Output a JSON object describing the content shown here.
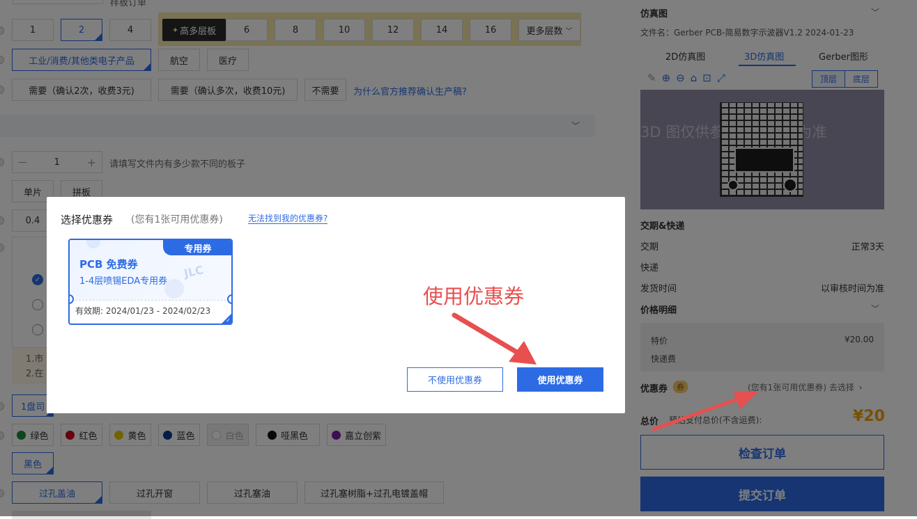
{
  "form": {
    "top_partial_text": "样板订单",
    "layers_row": [
      "1",
      "2",
      "4"
    ],
    "layers_high_label": "高多层板",
    "layers_high_options": [
      "6",
      "8",
      "10",
      "12",
      "14",
      "16"
    ],
    "layers_more": "更多层数",
    "usage_options": [
      "工业/消费/其他类电子产品",
      "航空",
      "医疗"
    ],
    "confirm_options": [
      "需要（确认2次，收费3元)",
      "需要（确认多次，收费10元)",
      "不需要"
    ],
    "confirm_link": "为什么官方推荐确认生产稿?",
    "qty_minus": "—",
    "qty_value": "1",
    "qty_plus": "+",
    "qty_hint": "请填写文件内有多少款不同的板子",
    "panel_options": [
      "单片",
      "拼板"
    ],
    "thickness_partial": "0.4",
    "note_lines": [
      "1.市",
      "2.在"
    ],
    "pack_partial": "1盘司",
    "colors": [
      {
        "label": "绿色",
        "color": "#1a8a3a"
      },
      {
        "label": "红色",
        "color": "#d0021b"
      },
      {
        "label": "黄色",
        "color": "#e6c300"
      },
      {
        "label": "蓝色",
        "color": "#0a3d91"
      },
      {
        "label": "白色",
        "color": "#ffffff"
      },
      {
        "label": "哑黑色",
        "color": "#111111"
      },
      {
        "label": "嘉立创紫",
        "color": "#7b1fa2"
      }
    ],
    "silk_color": "黑色",
    "via_options": [
      "过孔盖油",
      "过孔开窗",
      "过孔塞油",
      "过孔塞树脂+过孔电镀盖帽"
    ]
  },
  "right_panel": {
    "sim_title": "仿真图",
    "file_label": "文件名：Gerber PCB-简易数字示波器V1.2 2024-01-23",
    "tabs": [
      "2D仿真图",
      "3D仿真图",
      "Gerber图形"
    ],
    "view_buttons": [
      "顶层",
      "底层"
    ],
    "watermark": "3D 图仅供参考，以实物为准",
    "delivery_title": "交期&快递",
    "delivery_rows": [
      {
        "label": "交期",
        "value": "正常3天"
      },
      {
        "label": "快递",
        "value": ""
      },
      {
        "label": "发货时间",
        "value": "以审核时间为准"
      }
    ],
    "price_title": "价格明细",
    "price_rows": [
      {
        "label": "特价",
        "value": "¥20.00"
      },
      {
        "label": "快递费",
        "value": ""
      }
    ],
    "coupon_label": "优惠券",
    "coupon_badge": "券",
    "coupon_hint": "(您有1张可用优惠券) 去选择",
    "total_label": "总价",
    "total_sub": "预估支付总价(不含运费):",
    "total_value": "¥20",
    "check_button": "检查订单",
    "submit_button": "提交订单"
  },
  "modal": {
    "title": "选择优惠券",
    "subtitle": "(您有1张可用优惠券)",
    "link": "无法找到我的优惠券?",
    "coupon": {
      "tag": "专用券",
      "name": "PCB 免费券",
      "desc": "1-4层喷锡EDA专用券",
      "validity": "有效期: 2024/01/23 - 2024/02/23",
      "stamp": "JLC"
    },
    "cancel_button": "不使用优惠券",
    "confirm_button": "使用优惠券",
    "annotation": "使用优惠券"
  },
  "accent": "#2d6be4",
  "annotation_color": "#e84f4f"
}
